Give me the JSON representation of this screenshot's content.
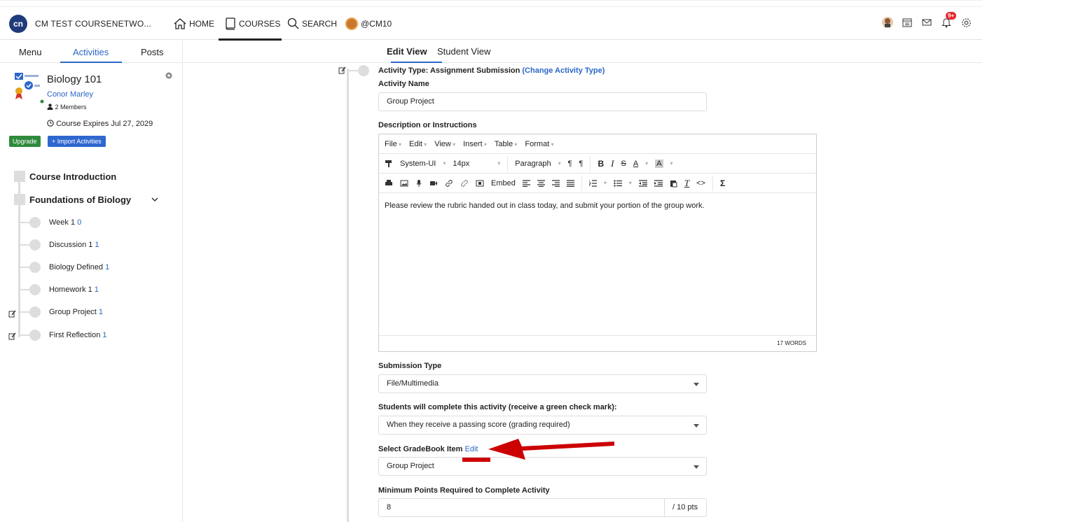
{
  "header": {
    "logo_text": "cn",
    "brand": "CM TEST COURSENETWO...",
    "nav": {
      "home": "HOME",
      "courses": "COURSES",
      "search": "SEARCH",
      "user": "@CM10"
    },
    "notification_badge": "9+"
  },
  "sidebar": {
    "tabs": [
      "Menu",
      "Activities",
      "Posts"
    ],
    "course": {
      "title": "Biology 101",
      "teacher": "Conor Marley",
      "members": "2 Members",
      "expires": "Course Expires Jul 27, 2029"
    },
    "buttons": {
      "upgrade": "Upgrade",
      "import": "+ Import Activities"
    },
    "sections": [
      {
        "label": "Course Introduction"
      },
      {
        "label": "Foundations of Biology"
      }
    ],
    "items": [
      {
        "label": "Week 1",
        "count": "0"
      },
      {
        "label": "Discussion 1",
        "count": "1"
      },
      {
        "label": "Biology Defined",
        "count": "1"
      },
      {
        "label": "Homework 1",
        "count": "1"
      },
      {
        "label": "Group Project",
        "count": "1"
      },
      {
        "label": "First Reflection",
        "count": "1"
      }
    ]
  },
  "main": {
    "tabs": [
      "Edit View",
      "Student View"
    ],
    "activity_type_label": "Activity Type: Assignment Submission",
    "change_type_link": "(Change Activity Type)",
    "activity_name_label": "Activity Name",
    "activity_name_value": "Group Project",
    "description_label": "Description or Instructions",
    "editor": {
      "menus": [
        "File",
        "Edit",
        "View",
        "Insert",
        "Table",
        "Format"
      ],
      "font": "System-UI",
      "size": "14px",
      "block": "Paragraph",
      "embed": "Embed",
      "content": "Please review the rubric handed out in class today, and submit your portion of the group work.",
      "word_count": "17 WORDS"
    },
    "submission_type_label": "Submission Type",
    "submission_type_value": "File/Multimedia",
    "completion_label": "Students will complete this activity (receive a green check mark):",
    "completion_value": "When they receive a passing score (grading required)",
    "gradebook_label": "Select GradeBook Item",
    "gradebook_edit": "Edit",
    "gradebook_value": "Group Project",
    "min_points_label": "Minimum Points Required to Complete Activity",
    "min_points_value": "8",
    "min_points_suffix": "/ 10 pts"
  },
  "colors": {
    "accent": "#2a66c9",
    "upgrade": "#2f8a3c",
    "arrow": "#cc0000",
    "badge": "#e3262d"
  }
}
